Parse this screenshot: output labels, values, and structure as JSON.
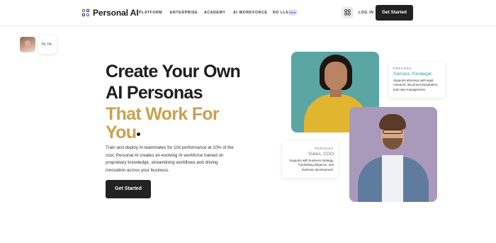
{
  "nav": {
    "logo_text": "Personal AI",
    "items": [
      {
        "label": "PLATFORM"
      },
      {
        "label": "ENTERPRISE"
      },
      {
        "label": "ACADEMY"
      },
      {
        "label": "AI WORKFORCE"
      },
      {
        "label": "NO LLM"
      }
    ],
    "new_badge": "NEW",
    "login": "LOG IN",
    "cta": "Get Started"
  },
  "chat": {
    "text": "Hi, I'm"
  },
  "hero": {
    "line1": "Create Your Own",
    "line2": "AI Personas",
    "line3": "That Work For",
    "line4": "You",
    "paragraph": "Train and deploy AI teammates for 10x performance at 10% of the cost. Personal AI creates an evolving AI workforce trained on proprietary knowledge, streamlining workflows and driving innovation across your business.",
    "cta": "Get Started"
  },
  "personas": [
    {
      "tag": "PERSONA",
      "name": "Samara, Paralegal",
      "description": "Supports attorneys with legal research, document preparation, and case management."
    },
    {
      "tag": "PERSONA",
      "name": "Gates, COO",
      "description": "Supports with business strategy, fundraising diligence, and business development."
    }
  ],
  "colors": {
    "accent_gold": "#c9a24f",
    "brand_purple": "#6b4fd8",
    "button_dark": "#222222"
  },
  "icons": {
    "logo": "logo-icon",
    "apps": "grid-icon"
  }
}
